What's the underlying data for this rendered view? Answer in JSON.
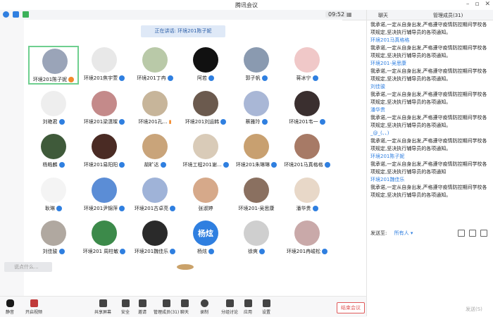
{
  "window": {
    "title": "腾讯会议"
  },
  "status": {
    "time": "09:52"
  },
  "stage": {
    "speaking": "正在讲话: 环境201陈子妮"
  },
  "participants": [
    {
      "name": "环境201陈子妮",
      "color": "#9aa4b8",
      "mic": "orange"
    },
    {
      "name": "环境201焦宇萱",
      "color": "#e8e8e8",
      "mic": "blue"
    },
    {
      "name": "环境201丁冉",
      "color": "#b9c9a8",
      "mic": "blue"
    },
    {
      "name": "阿若",
      "color": "#111111",
      "mic": "blue"
    },
    {
      "name": "郭子帆",
      "color": "#8a9ab0",
      "mic": "blue"
    },
    {
      "name": "蒋冰宁",
      "color": "#f0c8c8",
      "mic": "blue"
    },
    {
      "name": "刘艳君",
      "color": "#eeeeee",
      "mic": "blue"
    },
    {
      "name": "环境201梁潇璨",
      "color": "#c48a8a",
      "mic": "blue"
    },
    {
      "name": "环境201孔...",
      "color": "#c7b59a",
      "mic": "bars"
    },
    {
      "name": "环境201刘运韩",
      "color": "#6b5a4e",
      "mic": "blue"
    },
    {
      "name": "蔡雅玲",
      "color": "#a9b7d6",
      "mic": "blue"
    },
    {
      "name": "环境201韦一",
      "color": "#3a2f2f",
      "mic": "blue"
    },
    {
      "name": "杨皓麟",
      "color": "#3f5a3a",
      "mic": "blue"
    },
    {
      "name": "环境201易阳阳",
      "color": "#4a2b24",
      "mic": "blue"
    },
    {
      "name": "胡旷达",
      "color": "#c9a47a",
      "mic": "blue"
    },
    {
      "name": "环境工程201谢...",
      "color": "#d9cbb8",
      "mic": "blue"
    },
    {
      "name": "环境201朱琳琳",
      "color": "#c8a070",
      "mic": "blue"
    },
    {
      "name": "环境201马真格格",
      "color": "#a77a66",
      "mic": "blue"
    },
    {
      "name": "耿琳",
      "color": "#f4f4f4",
      "mic": "blue"
    },
    {
      "name": "环境201尹锦萍",
      "color": "#5b8dd6",
      "mic": "blue"
    },
    {
      "name": "环境201古卓亮",
      "color": "#9fb3d8",
      "mic": "blue"
    },
    {
      "name": "张淑婷",
      "color": "#d6a98a",
      "mic": "none"
    },
    {
      "name": "环境201-吴思康",
      "color": "#8a7060",
      "mic": "none"
    },
    {
      "name": "潘华贵",
      "color": "#e8d8c8",
      "mic": "blue"
    },
    {
      "name": "刘佳骏",
      "color": "#b0a8a0",
      "mic": "blue"
    },
    {
      "name": "环境201 周柱敏",
      "color": "#3c8a4a",
      "mic": "blue"
    },
    {
      "name": "环境201魏佳乐",
      "color": "#2a2a2a",
      "mic": "blue"
    },
    {
      "name": "杨炫",
      "color": "#2f7fe0",
      "mic": "blue",
      "initials": "杨炫"
    },
    {
      "name": "徐爽",
      "color": "#cfcfcf",
      "mic": "blue"
    },
    {
      "name": "环境201冉峻松",
      "color": "#c9a9a9",
      "mic": "blue"
    }
  ],
  "chat_input": {
    "placeholder": "说点什么..."
  },
  "toolbar": {
    "mute": "静音",
    "video": "开启视频",
    "share": "共享屏幕",
    "security": "安全",
    "invite": "邀请",
    "members": "管理成员(31)",
    "chat": "聊天",
    "record": "录制",
    "breakout": "分组讨论",
    "apps": "应用",
    "settings": "设置",
    "end": "结束会议"
  },
  "panel": {
    "tab_chat": "聊天",
    "tab_members": "管理成员(31)",
    "messages": [
      {
        "sender": "",
        "text": "我承诺,一定从自身出发,严格遵守疫情防控期间学校各项规定,坚决执行辅导员的各项通知。"
      },
      {
        "sender": "环境201马真格格",
        "text": "我承诺,一定从自身出发,严格遵守疫情防控期间学校各项规定,坚决执行辅导员的各项通知。"
      },
      {
        "sender": "环境201-吴思康",
        "text": "我承诺,一定从自身出发,严格遵守疫情防控期间学校各项规定,坚决执行辅导员的各项通知。"
      },
      {
        "sender": "刘佳骏",
        "text": "我承诺,一定从自身出发,严格遵守疫情防控期间学校各项规定,坚决执行辅导员的各项通知。"
      },
      {
        "sender": "潘华贵",
        "text": "我承诺,一定从自身出发,严格遵守疫情防控期间学校各项规定,坚决执行辅导员的各项通知。"
      },
      {
        "sender": "_@_(、、)",
        "text": "我承诺,一定从自身出发,严格遵守疫情防控期间学校各项规定,坚决执行辅导员的各项通知。"
      },
      {
        "sender": "环境201陈子妮",
        "text": "我承诺,一定从自身出发,严格遵守疫情防控期间学校各项规定,坚决执行辅导员的各项通知"
      },
      {
        "sender": "环境201魏佳乐",
        "text": "我承诺,一定从自身出发,严格遵守疫情防控期间学校各项规定,坚决执行辅导员的各项通知。"
      }
    ],
    "send_to_label": "发送至:",
    "send_to_value": "所有人 ▾",
    "send_button": "发送(S)"
  }
}
